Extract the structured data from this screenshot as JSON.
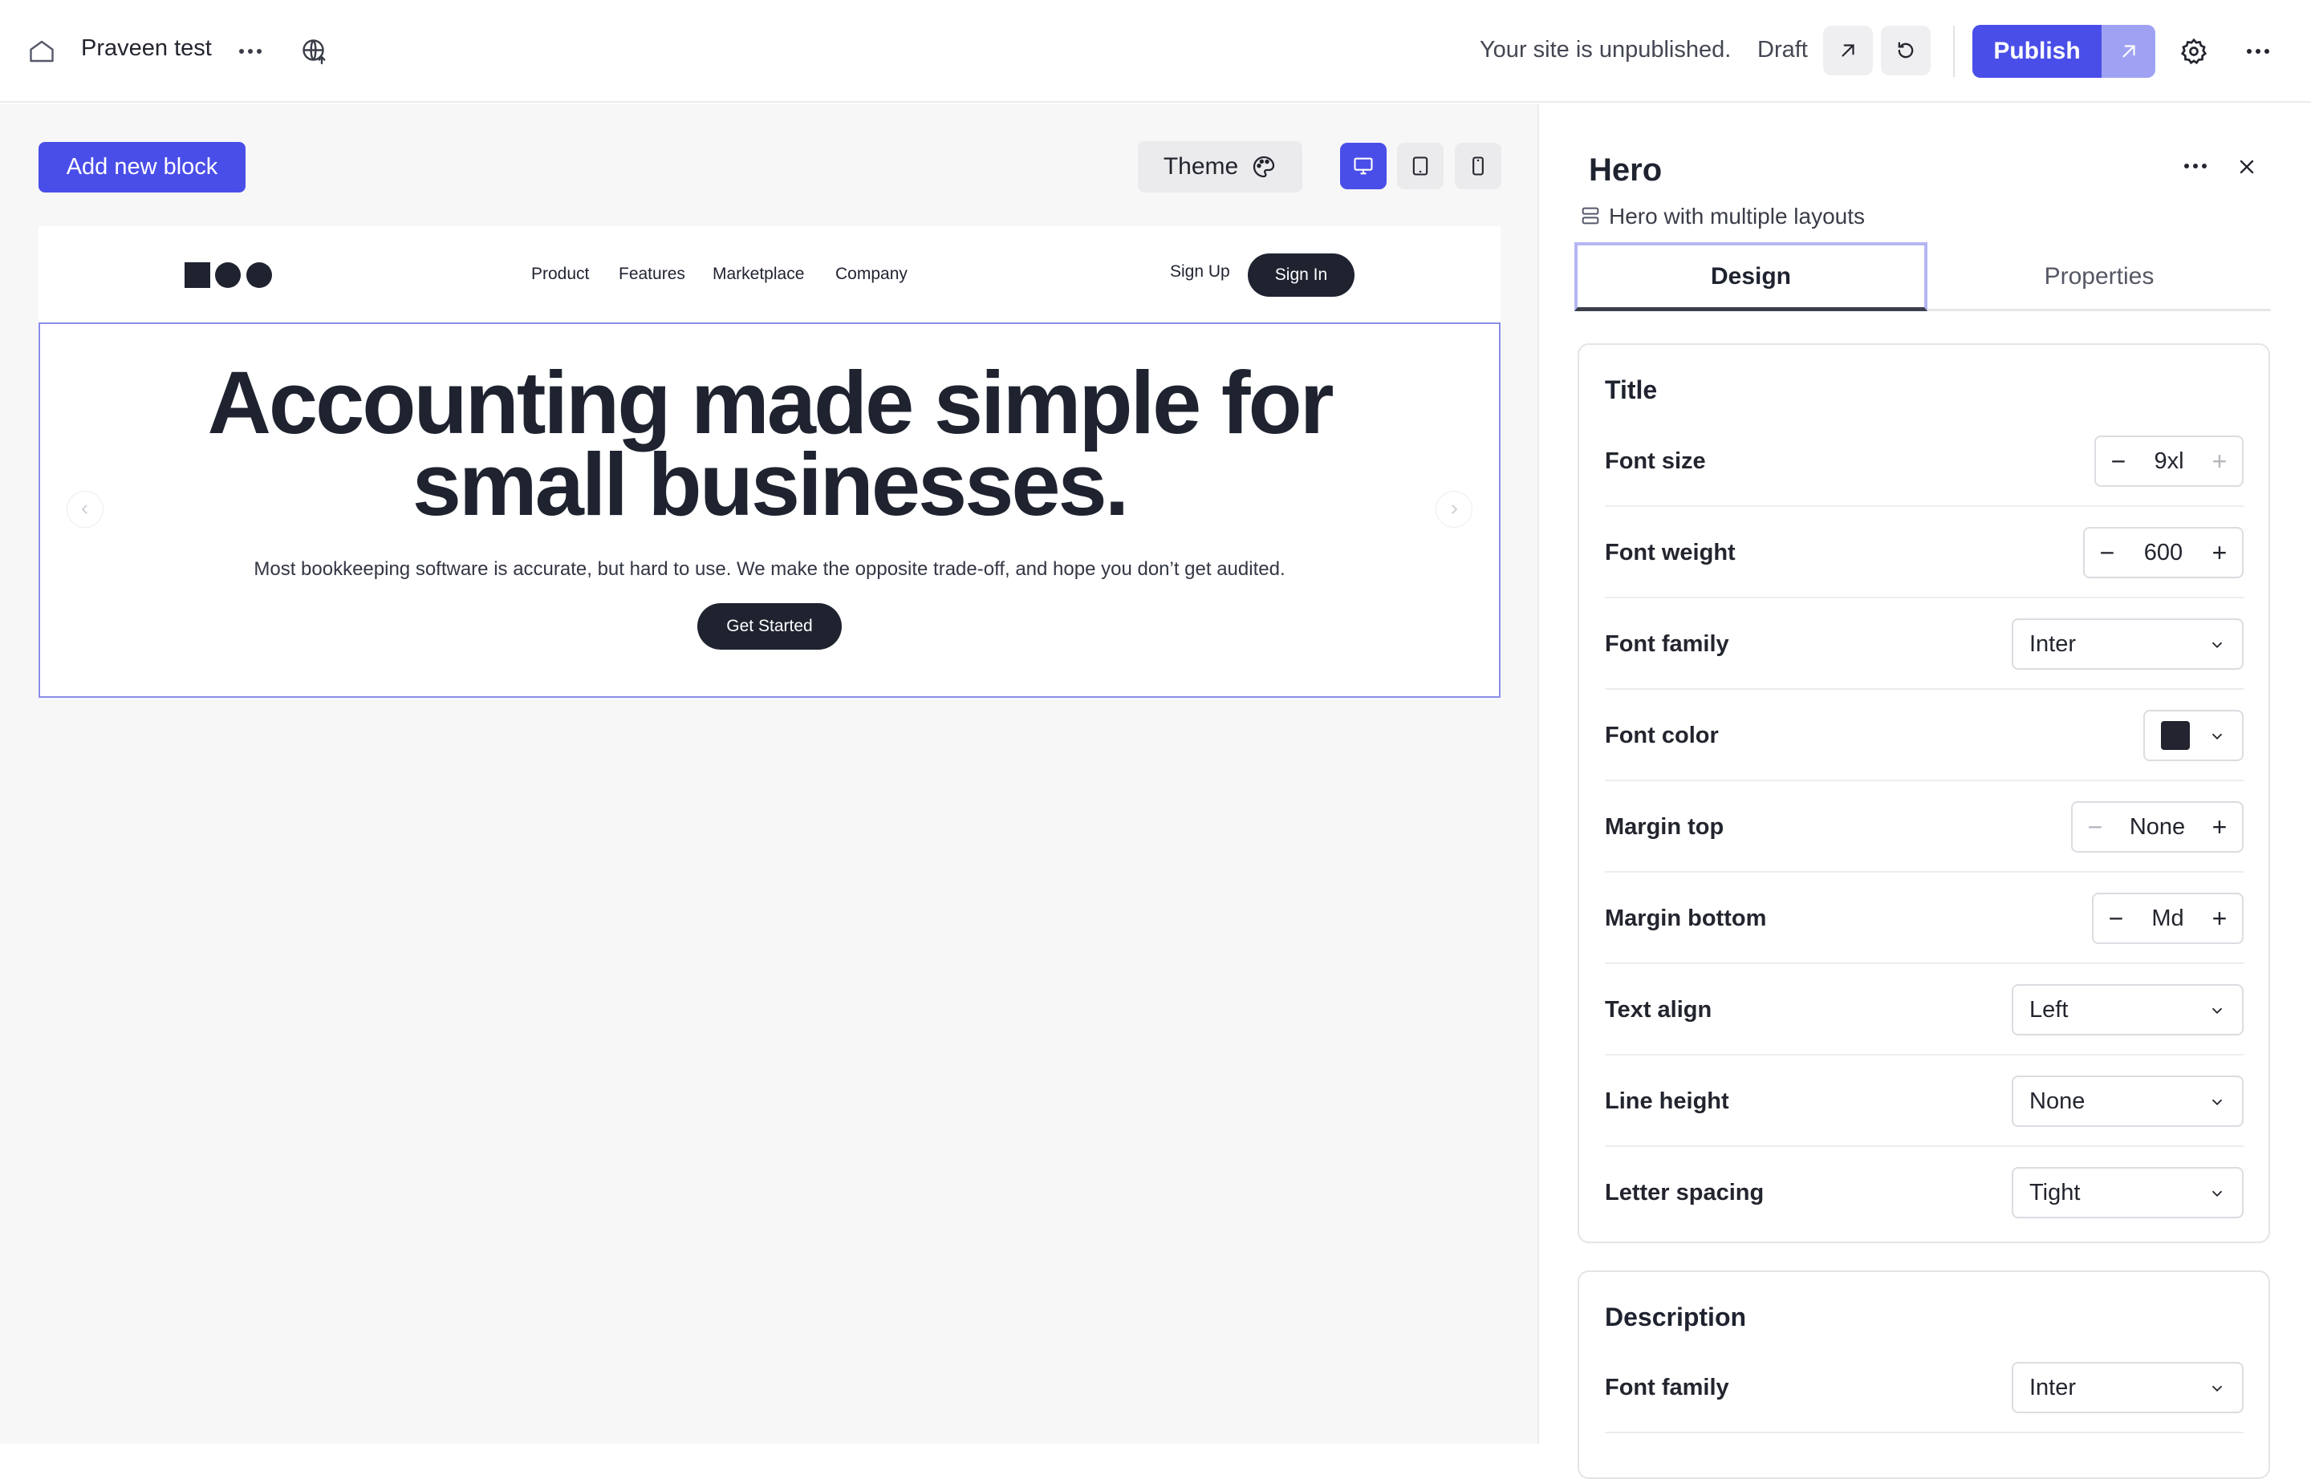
{
  "topbar": {
    "site_name": "Praveen test",
    "status_text": "Your site is unpublished.",
    "draft_label": "Draft",
    "publish_label": "Publish"
  },
  "toolbar": {
    "add_block_label": "Add new block",
    "theme_label": "Theme",
    "devices": [
      "desktop",
      "tablet",
      "mobile"
    ],
    "active_device": "desktop"
  },
  "preview": {
    "nav": {
      "links": [
        "Product",
        "Features",
        "Marketplace",
        "Company"
      ],
      "signup_label": "Sign Up",
      "signin_label": "Sign In"
    },
    "hero": {
      "title_line1": "Accounting made simple for",
      "title_line2": "small businesses.",
      "description": "Most bookkeeping software is accurate, but hard to use. We make the opposite trade-off, and hope you don’t get audited.",
      "cta_label": "Get Started"
    }
  },
  "panel": {
    "title": "Hero",
    "subtitle": "Hero with multiple layouts",
    "tabs": [
      "Design",
      "Properties"
    ],
    "active_tab": "Design",
    "title_section": {
      "heading": "Title",
      "font_size": {
        "label": "Font size",
        "value": "9xl"
      },
      "font_weight": {
        "label": "Font weight",
        "value": "600"
      },
      "font_family": {
        "label": "Font family",
        "value": "Inter"
      },
      "font_color": {
        "label": "Font color",
        "value": "#23242f"
      },
      "margin_top": {
        "label": "Margin top",
        "value": "None"
      },
      "margin_bottom": {
        "label": "Margin bottom",
        "value": "Md"
      },
      "text_align": {
        "label": "Text align",
        "value": "Left"
      },
      "line_height": {
        "label": "Line height",
        "value": "None"
      },
      "letter_spacing": {
        "label": "Letter spacing",
        "value": "Tight"
      }
    },
    "description_section": {
      "heading": "Description",
      "font_family": {
        "label": "Font family",
        "value": "Inter"
      }
    }
  },
  "colors": {
    "accent": "#4a4ee8",
    "accent_light": "#9fa2f3",
    "dark": "#1f2330",
    "canvas_bg": "#f7f7f8"
  }
}
